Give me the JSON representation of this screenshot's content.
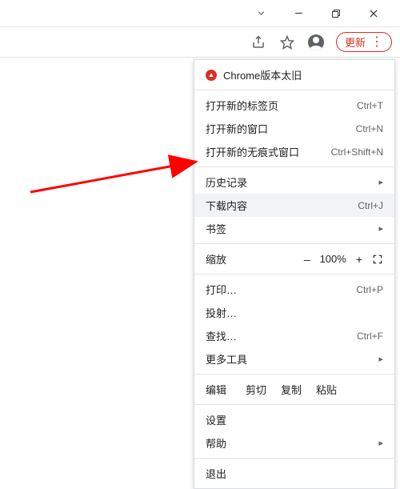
{
  "toolbar": {
    "update_label": "更新"
  },
  "menu": {
    "warning": "Chrome版本太旧",
    "new_tab": {
      "label": "打开新的标签页",
      "shortcut": "Ctrl+T"
    },
    "new_window": {
      "label": "打开新的窗口",
      "shortcut": "Ctrl+N"
    },
    "incognito": {
      "label": "打开新的无痕式窗口",
      "shortcut": "Ctrl+Shift+N"
    },
    "history": {
      "label": "历史记录"
    },
    "downloads": {
      "label": "下载内容",
      "shortcut": "Ctrl+J"
    },
    "bookmarks": {
      "label": "书签"
    },
    "zoom": {
      "label": "缩放",
      "minus": "–",
      "value": "100%",
      "plus": "+"
    },
    "print": {
      "label": "打印…",
      "shortcut": "Ctrl+P"
    },
    "cast": {
      "label": "投射…"
    },
    "find": {
      "label": "查找…",
      "shortcut": "Ctrl+F"
    },
    "more_tools": {
      "label": "更多工具"
    },
    "edit": {
      "label": "编辑",
      "cut": "剪切",
      "copy": "复制",
      "paste": "粘贴"
    },
    "settings": {
      "label": "设置"
    },
    "help": {
      "label": "帮助"
    },
    "exit": {
      "label": "退出"
    }
  }
}
